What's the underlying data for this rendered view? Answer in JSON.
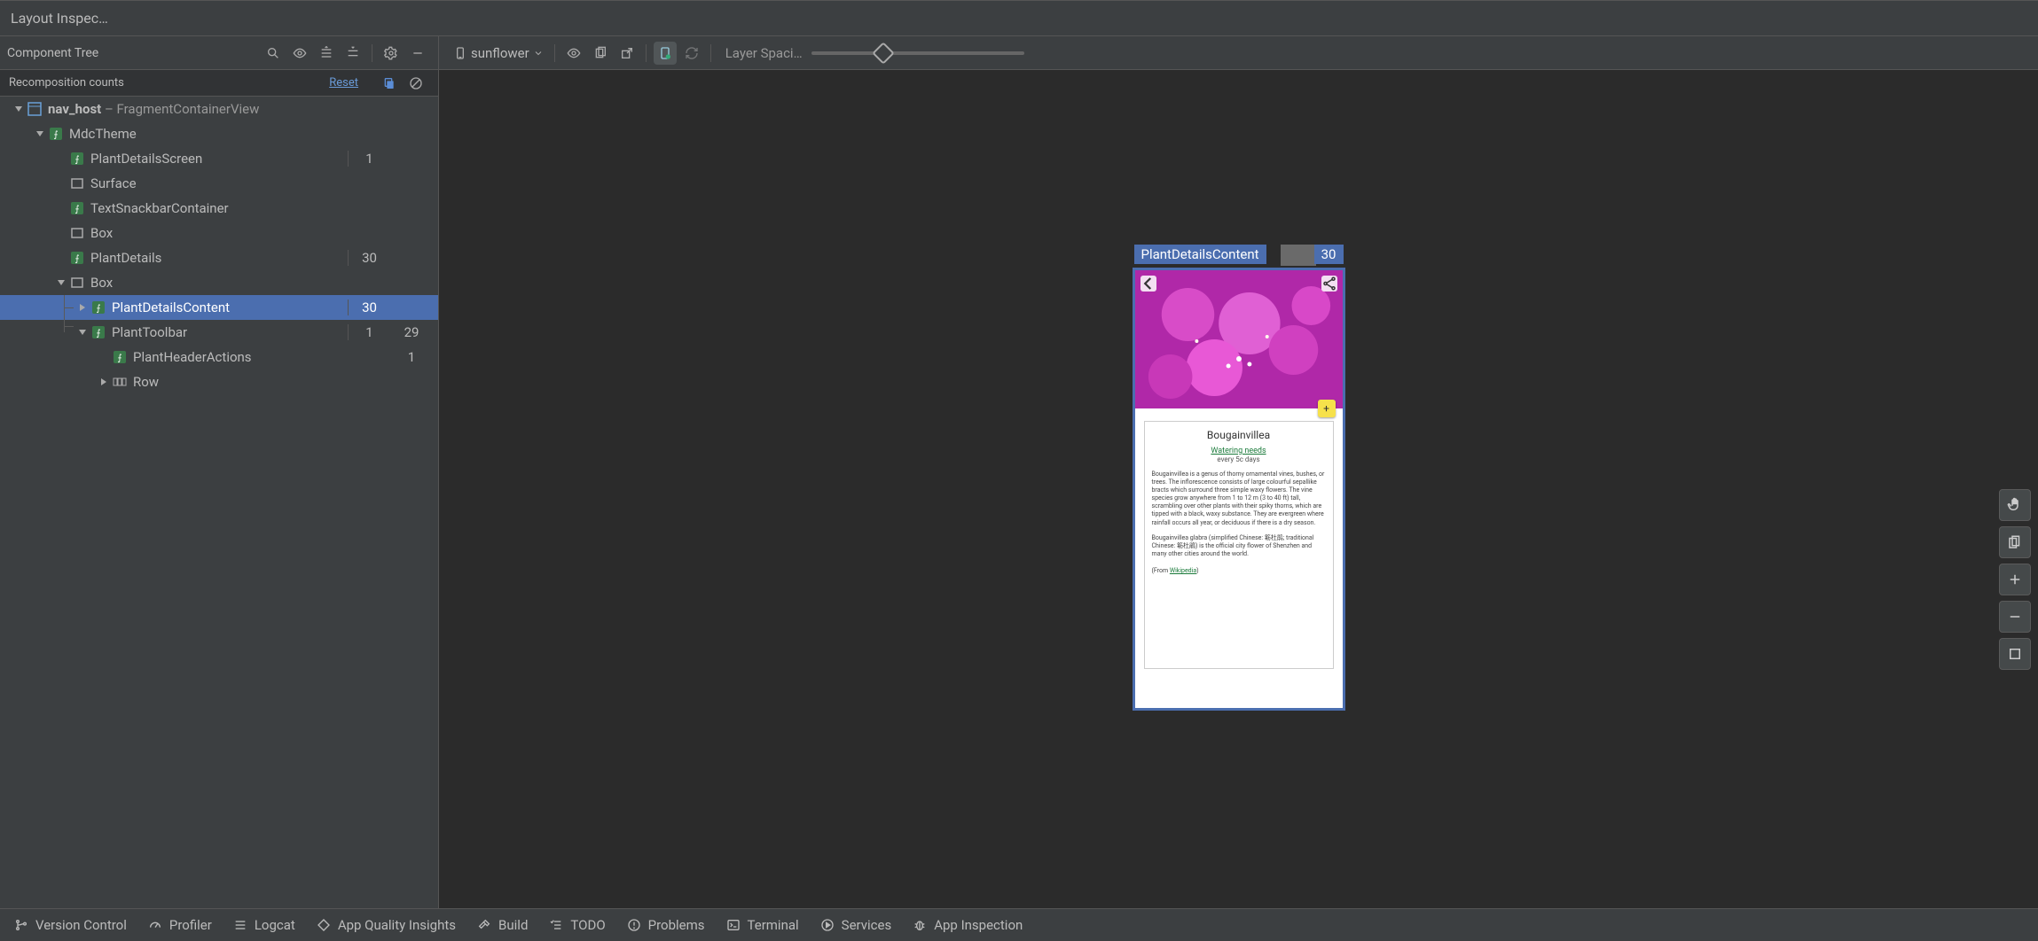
{
  "title": "Layout Inspec…",
  "left": {
    "component_tree_label": "Component Tree",
    "recomp_label": "Recomposition counts",
    "reset_label": "Reset",
    "nodes": [
      {
        "id": "nav_host",
        "label_bold": "nav_host",
        "label_tail": " – FragmentContainerView",
        "icon": "view",
        "indent": 0,
        "arrow": "down",
        "count": "",
        "skip": ""
      },
      {
        "id": "mdctheme",
        "label": "MdcTheme",
        "icon": "compose",
        "indent": 1,
        "arrow": "down",
        "count": "",
        "skip": ""
      },
      {
        "id": "plantdetailsscreen",
        "label": "PlantDetailsScreen",
        "icon": "compose",
        "indent": 2,
        "arrow": "",
        "count": "1",
        "skip": ""
      },
      {
        "id": "surface",
        "label": "Surface",
        "icon": "layout",
        "indent": 2,
        "arrow": "",
        "count": "",
        "skip": ""
      },
      {
        "id": "textsnackbar",
        "label": "TextSnackbarContainer",
        "icon": "compose",
        "indent": 2,
        "arrow": "",
        "count": "",
        "skip": ""
      },
      {
        "id": "box1",
        "label": "Box",
        "icon": "layout",
        "indent": 2,
        "arrow": "",
        "count": "",
        "skip": ""
      },
      {
        "id": "plantdetails",
        "label": "PlantDetails",
        "icon": "compose",
        "indent": 2,
        "arrow": "",
        "count": "30",
        "skip": ""
      },
      {
        "id": "box2",
        "label": "Box",
        "icon": "layout",
        "indent": 2,
        "arrow": "down",
        "count": "",
        "skip": ""
      },
      {
        "id": "plantdetailscontent",
        "label": "PlantDetailsContent",
        "icon": "compose",
        "indent": 3,
        "arrow": "right",
        "count": "30",
        "skip": "",
        "selected": true,
        "connector": "tee"
      },
      {
        "id": "planttoolbar",
        "label": "PlantToolbar",
        "icon": "compose",
        "indent": 3,
        "arrow": "down",
        "count": "1",
        "skip": "29",
        "connector": "end"
      },
      {
        "id": "plantheaderactions",
        "label": "PlantHeaderActions",
        "icon": "compose",
        "indent": 4,
        "arrow": "",
        "count": "",
        "skip": "1"
      },
      {
        "id": "row",
        "label": "Row",
        "icon": "row",
        "indent": 4,
        "arrow": "right",
        "count": "",
        "skip": ""
      }
    ]
  },
  "right": {
    "process": "sunflower",
    "layer_label": "Layer Spaci…",
    "selection_label": "PlantDetailsContent",
    "selection_count": "30",
    "plant": {
      "name": "Bougainvillea",
      "water_header": "Watering needs",
      "water_value": "every 5c days",
      "para1": "Bougainvillea is a genus of thorny ornamental vines, bushes, or trees. The inflorescence consists of large colourful sepallike bracts which surround three simple waxy flowers. The vine species grow anywhere from 1 to 12 m (3 to 40 ft) tall, scrambling over other plants with their spiky thorns, which are tipped with a black, waxy substance. They are evergreen where rainfall occurs all year, or deciduous if there is a dry season.",
      "para2": "Bougainvillea glabra (simplified Chinese: 簕杜鹃; traditional Chinese: 簕杜鵑) is the official city flower of Shenzhen and many other cities around the world.",
      "from_text": "(From ",
      "from_link": "Wikipedia",
      "from_tail": ")"
    }
  },
  "bottom": {
    "items": [
      {
        "id": "version-control",
        "label": "Version Control",
        "icon": "branch"
      },
      {
        "id": "profiler",
        "label": "Profiler",
        "icon": "gauge"
      },
      {
        "id": "logcat",
        "label": "Logcat",
        "icon": "list"
      },
      {
        "id": "app-quality",
        "label": "App Quality Insights",
        "icon": "diamond"
      },
      {
        "id": "build",
        "label": "Build",
        "icon": "hammer"
      },
      {
        "id": "todo",
        "label": "TODO",
        "icon": "checklist"
      },
      {
        "id": "problems",
        "label": "Problems",
        "icon": "warn"
      },
      {
        "id": "terminal",
        "label": "Terminal",
        "icon": "terminal"
      },
      {
        "id": "services",
        "label": "Services",
        "icon": "play"
      },
      {
        "id": "app-inspection",
        "label": "App Inspection",
        "icon": "bug"
      }
    ]
  }
}
